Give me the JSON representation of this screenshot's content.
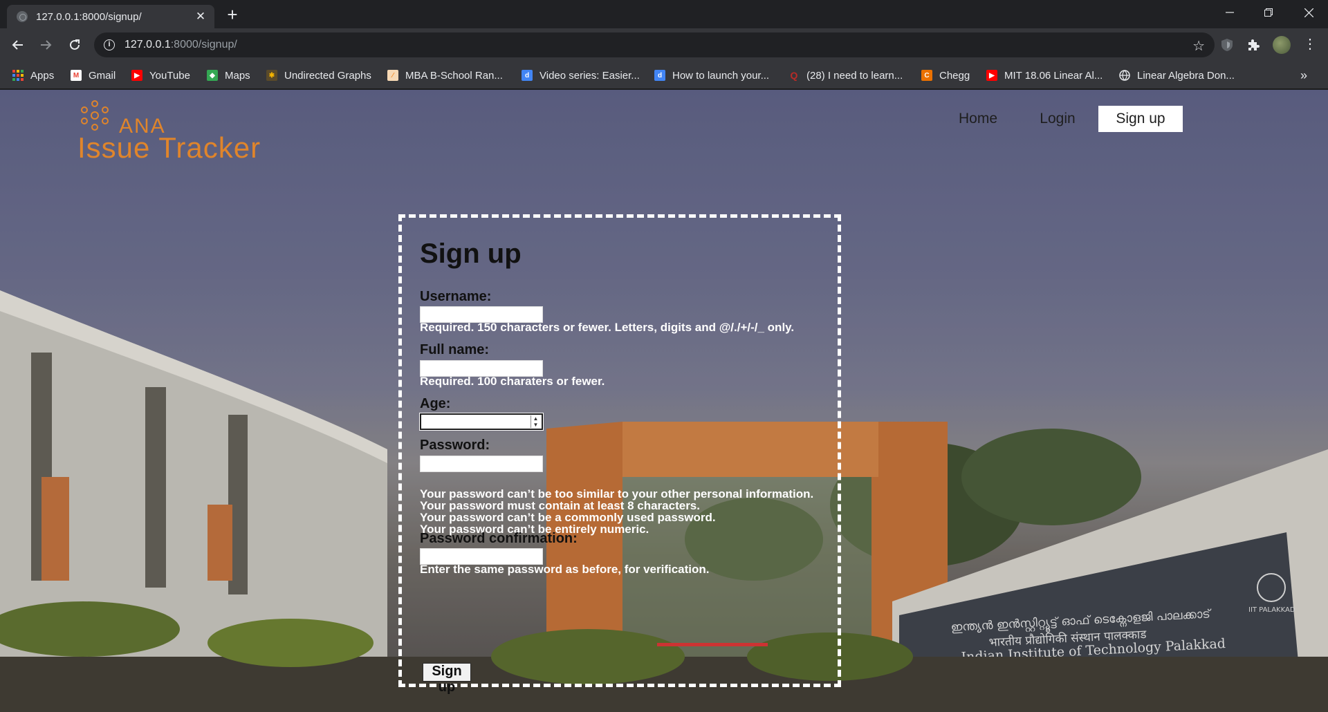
{
  "browser": {
    "tab_title": "127.0.0.1:8000/signup/",
    "url_host": "127.0.0.1",
    "url_path": ":8000/signup/",
    "bookmarks": [
      {
        "label": "Apps",
        "icon": "apps-grid-icon",
        "color": "#ea4335"
      },
      {
        "label": "Gmail",
        "icon": "gmail-icon",
        "color": "#ea4335"
      },
      {
        "label": "YouTube",
        "icon": "youtube-icon",
        "color": "#ff0000"
      },
      {
        "label": "Maps",
        "icon": "maps-icon",
        "color": "#34a853"
      },
      {
        "label": "Undirected Graphs",
        "icon": "graph-icon",
        "color": "#f4b400"
      },
      {
        "label": "MBA B-School Ran...",
        "icon": "chart-icon",
        "color": "#f28c28"
      },
      {
        "label": "Video series: Easier...",
        "icon": "doc-icon",
        "color": "#4285f4"
      },
      {
        "label": "How to launch your...",
        "icon": "doc-icon",
        "color": "#4285f4"
      },
      {
        "label": "(28) I need to learn...",
        "icon": "quora-icon",
        "color": "#b92b27"
      },
      {
        "label": "Chegg",
        "icon": "chegg-icon",
        "color": "#eb7100"
      },
      {
        "label": "MIT 18.06 Linear Al...",
        "icon": "youtube-icon",
        "color": "#ff0000"
      },
      {
        "label": "Linear Algebra Don...",
        "icon": "globe-icon",
        "color": "#e8eaed"
      }
    ],
    "more_bookmarks": "»"
  },
  "site": {
    "logo_top": "ANA",
    "logo_main": "Issue Tracker",
    "nav": {
      "home": "Home",
      "login": "Login",
      "signup": "Sign up"
    }
  },
  "form": {
    "title": "Sign up",
    "username_label": "Username:",
    "username_help": "Required. 150 characters or fewer. Letters, digits and @/./+/-/_ only.",
    "fullname_label": "Full name:",
    "fullname_help": "Required. 100 charaters or fewer.",
    "age_label": "Age:",
    "password_label": "Password:",
    "password_help": [
      "Your password can’t be too similar to your other personal information.",
      "Your password must contain at least 8 characters.",
      "Your password can’t be a commonly used password.",
      "Your password can’t be entirely numeric."
    ],
    "password2_label": "Password confirmation:",
    "password2_help": "Enter the same password as before, for verification.",
    "submit_label": "Sign up"
  },
  "background": {
    "sign_malayalam": "ഇന്ത്യൻ ഇൻസ്റ്റിറ്റ്യൂട്ട് ഓഫ് ടെക്നോളജി പാലക്കാട്",
    "sign_hindi": "भारतीय प्रौद्योगिकी संस्थान पालक्काड",
    "sign_english": "Indian Institute of Technology Palakkad",
    "sign_logo_text": "IIT PALAKKAD"
  }
}
